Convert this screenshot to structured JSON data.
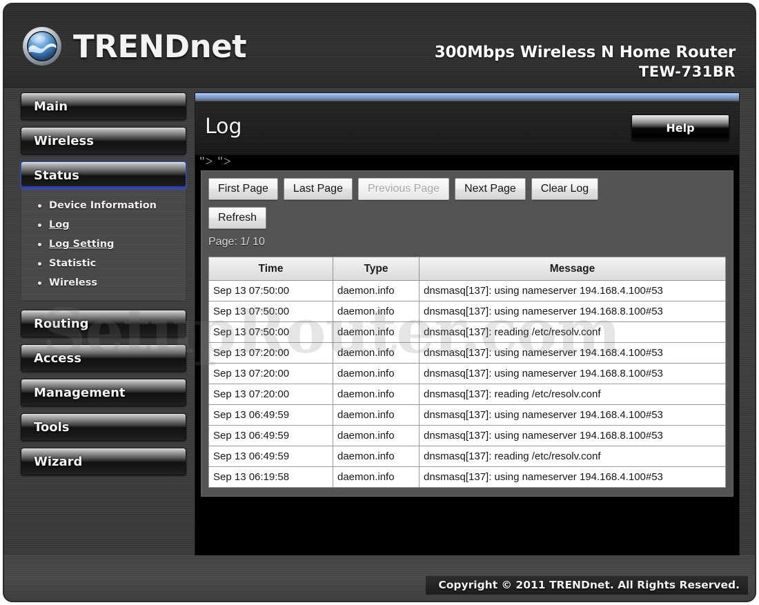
{
  "header": {
    "brand": "TRENDnet",
    "logo_icon": "trendnet-globe-logo-icon",
    "product_line1": "300Mbps Wireless N Home Router",
    "product_line2": "TEW-731BR"
  },
  "sidebar": {
    "items": [
      {
        "label": "Main",
        "active": false
      },
      {
        "label": "Wireless",
        "active": false
      },
      {
        "label": "Status",
        "active": true
      },
      {
        "label": "Routing",
        "active": false
      },
      {
        "label": "Access",
        "active": false
      },
      {
        "label": "Management",
        "active": false
      },
      {
        "label": "Tools",
        "active": false
      },
      {
        "label": "Wizard",
        "active": false
      }
    ],
    "submenu": [
      {
        "label": "Device Information",
        "link": false
      },
      {
        "label": "Log",
        "link": true
      },
      {
        "label": "Log Setting",
        "link": true
      },
      {
        "label": "Statistic",
        "link": false
      },
      {
        "label": "Wireless",
        "link": false
      }
    ]
  },
  "content": {
    "title": "Log",
    "help_label": "Help",
    "breadcrumb": "\"> \">",
    "buttons": [
      {
        "label": "First Page",
        "disabled": false
      },
      {
        "label": "Last Page",
        "disabled": false
      },
      {
        "label": "Previous Page",
        "disabled": true
      },
      {
        "label": "Next Page",
        "disabled": false
      },
      {
        "label": "Clear Log",
        "disabled": false
      }
    ],
    "refresh_label": "Refresh",
    "page_indicator": "Page: 1/ 10",
    "table": {
      "columns": [
        "Time",
        "Type",
        "Message"
      ],
      "rows": [
        [
          "Sep 13 07:50:00",
          "daemon.info",
          "dnsmasq[137]: using nameserver 194.168.4.100#53"
        ],
        [
          "Sep 13 07:50:00",
          "daemon.info",
          "dnsmasq[137]: using nameserver 194.168.8.100#53"
        ],
        [
          "Sep 13 07:50:00",
          "daemon.info",
          "dnsmasq[137]: reading /etc/resolv.conf"
        ],
        [
          "Sep 13 07:20:00",
          "daemon.info",
          "dnsmasq[137]: using nameserver 194.168.4.100#53"
        ],
        [
          "Sep 13 07:20:00",
          "daemon.info",
          "dnsmasq[137]: using nameserver 194.168.8.100#53"
        ],
        [
          "Sep 13 07:20:00",
          "daemon.info",
          "dnsmasq[137]: reading /etc/resolv.conf"
        ],
        [
          "Sep 13 06:49:59",
          "daemon.info",
          "dnsmasq[137]: using nameserver 194.168.4.100#53"
        ],
        [
          "Sep 13 06:49:59",
          "daemon.info",
          "dnsmasq[137]: using nameserver 194.168.8.100#53"
        ],
        [
          "Sep 13 06:49:59",
          "daemon.info",
          "dnsmasq[137]: reading /etc/resolv.conf"
        ],
        [
          "Sep 13 06:19:58",
          "daemon.info",
          "dnsmasq[137]: using nameserver 194.168.4.100#53"
        ]
      ]
    }
  },
  "watermark": "SetupRouter.com",
  "footer": {
    "copyright": "Copyright © 2011 TRENDnet. All Rights Reserved."
  },
  "colors": {
    "accent_blue": "#2c50b8",
    "panel_bg": "#545454",
    "frame_bg": "#3e3e3e",
    "table_bg": "#ffffff"
  }
}
